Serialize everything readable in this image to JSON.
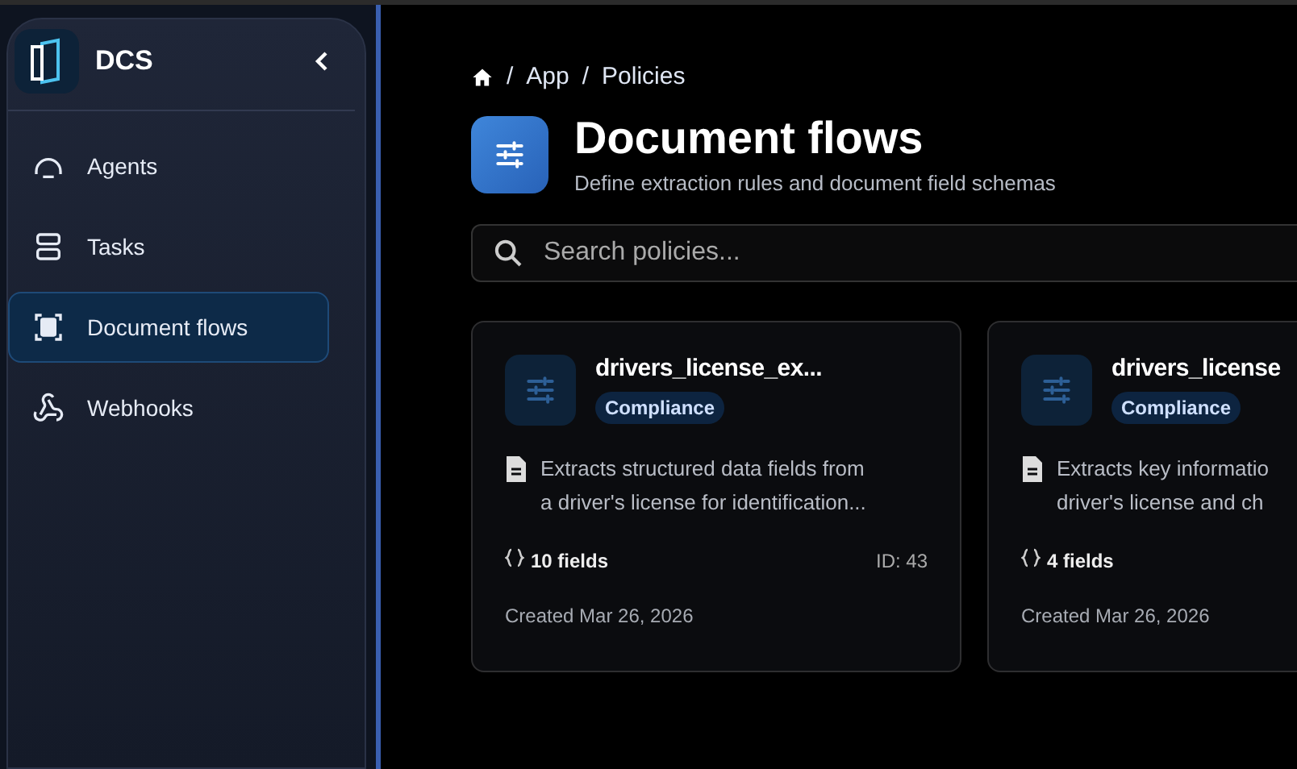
{
  "sidebar": {
    "brand": "DCS",
    "items": [
      {
        "label": "Agents",
        "selected": false
      },
      {
        "label": "Tasks",
        "selected": false
      },
      {
        "label": "Document flows",
        "selected": true
      },
      {
        "label": "Webhooks",
        "selected": false
      }
    ]
  },
  "breadcrumb": [
    {
      "separator": "/",
      "label": "App"
    },
    {
      "separator": "/",
      "label": "Policies"
    }
  ],
  "header": {
    "title": "Document flows",
    "subtitle": "Define extraction rules and document field schemas"
  },
  "search": {
    "placeholder": "Search policies..."
  },
  "cards": [
    {
      "name": "drivers_license_ex...",
      "tag": "Compliance",
      "description": [
        "Extracts structured data fields from",
        "a driver's license for identification..."
      ],
      "fields": "10 fields",
      "id": "ID: 43",
      "created": "Created Mar 26, 2026"
    },
    {
      "name": "drivers_license",
      "tag": "Compliance",
      "description": [
        "Extracts key informatio",
        "driver's license and ch"
      ],
      "fields": "4 fields",
      "created": "Created Mar 26, 2026"
    }
  ]
}
